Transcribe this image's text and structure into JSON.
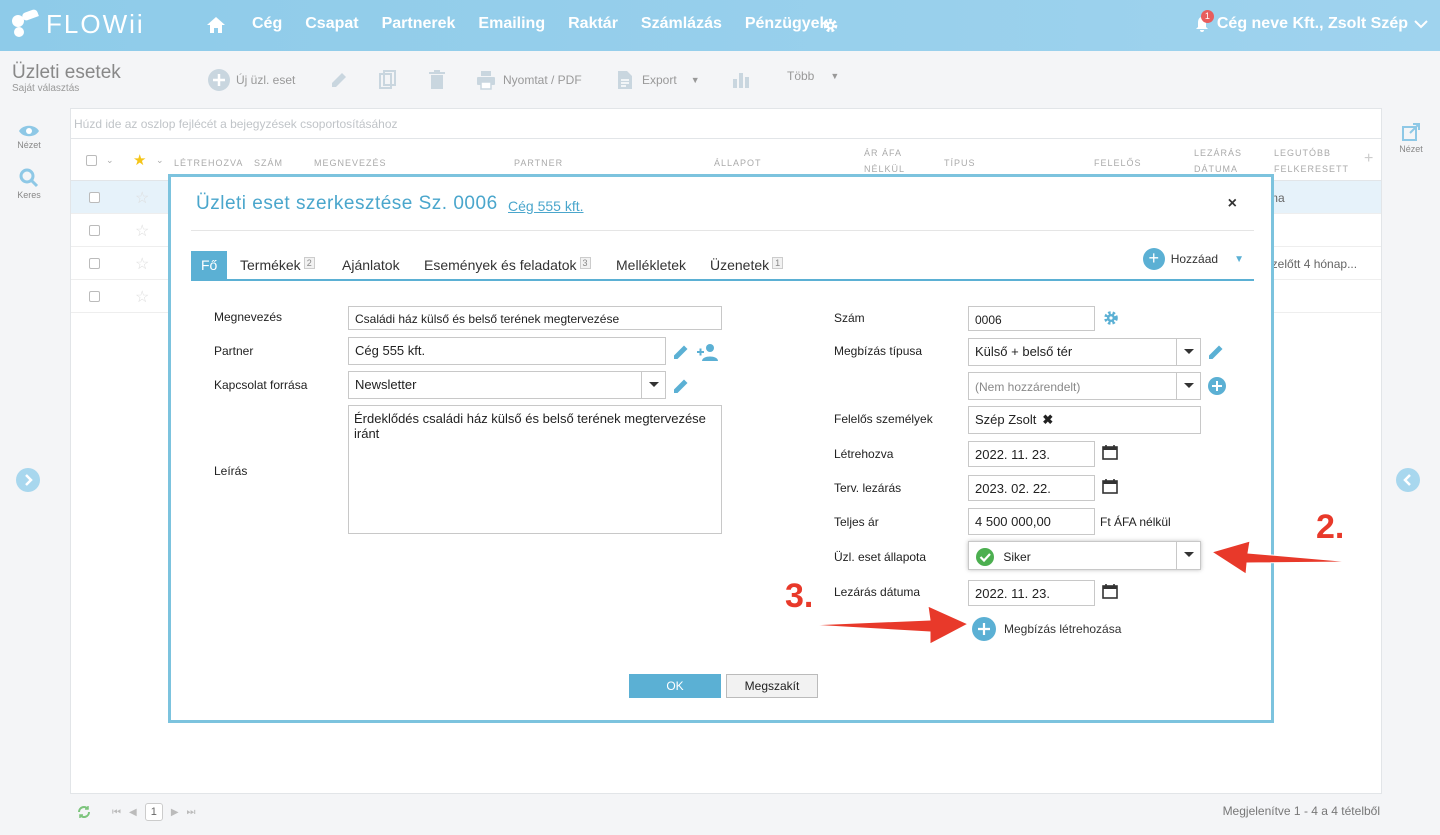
{
  "app": {
    "logo_text": "FLOWii",
    "nav": [
      "Cég",
      "Csapat",
      "Partnerek",
      "Emailing",
      "Raktár",
      "Számlázás",
      "Pénzügyek"
    ],
    "notification_count": "1",
    "account": "Cég neve Kft., Zsolt Szép"
  },
  "toolbar": {
    "title": "Üzleti esetek",
    "subtitle": "Saját választás",
    "new_label": "Új üzl. eset",
    "print_label": "Nyomtat / PDF",
    "export_label": "Export",
    "more_label": "Több"
  },
  "side": {
    "view_label": "Nézet",
    "search_label": "Keres",
    "right_view_label": "Nézet"
  },
  "grid": {
    "group_hint": "Húzd ide az oszlop fejlécét a bejegyzések csoportosításához",
    "columns": {
      "created": "Létrehozva",
      "number": "Szám",
      "name": "Megnevezés",
      "partner": "Partner",
      "status": "Állapot",
      "price_line1": "Ár ÁFA",
      "price_line2": "nélkül",
      "type": "Típus",
      "owner": "Felelős",
      "close_line1": "Lezárás",
      "close_line2": "dátuma",
      "last_line1": "Legutóbb",
      "last_line2": "felkeresett"
    },
    "row1_tail": "ma",
    "row3_tail": "ezelőtt  4 hónap..."
  },
  "footer": {
    "page": "1",
    "info": "Megjelenítve 1 - 4 a 4 tételből"
  },
  "modal": {
    "title": "Üzleti eset szerkesztése Sz. 0006",
    "partner_link": "Cég 555 kft.",
    "close": "×",
    "tabs": [
      {
        "label": "Fő",
        "badge": ""
      },
      {
        "label": "Termékek",
        "badge": "2"
      },
      {
        "label": "Ajánlatok",
        "badge": ""
      },
      {
        "label": "Események és feladatok",
        "badge": "3"
      },
      {
        "label": "Mellékletek",
        "badge": ""
      },
      {
        "label": "Üzenetek",
        "badge": "1"
      }
    ],
    "add_label": "Hozzáad",
    "left": {
      "name_label": "Megnevezés",
      "name_value": "Családi ház külső és belső terének megtervezése",
      "partner_label": "Partner",
      "partner_value": "Cég 555 kft.",
      "source_label": "Kapcsolat forrása",
      "source_value": "Newsletter",
      "desc_label": "Leírás",
      "desc_value": "Érdeklődés családi ház külső és belső terének megtervezése iránt"
    },
    "right": {
      "number_label": "Szám",
      "number_value": "0006",
      "type_label": "Megbízás típusa",
      "type_value": "Külső + belső tér",
      "type2_placeholder": "(Nem hozzárendelt)",
      "owners_label": "Felelős személyek",
      "owner_value": "Szép Zsolt",
      "created_label": "Létrehozva",
      "created_value": "2022. 11. 23.",
      "planned_label": "Terv. lezárás",
      "planned_value": "2023. 02. 22.",
      "price_label": "Teljes ár",
      "price_value": "4 500 000,00",
      "price_unit": "Ft  ÁFA nélkül",
      "status_label": "Üzl. eset állapota",
      "status_value": "Siker",
      "close_label": "Lezárás dátuma",
      "close_value": "2022. 11. 23.",
      "create_order": "Megbízás létrehozása"
    },
    "ok": "OK",
    "cancel": "Megszakít"
  },
  "annotations": {
    "two": "2.",
    "three": "3."
  },
  "colors": {
    "accent": "#5bb0d4",
    "nav_bg": "#9fd3ee",
    "annotation": "#e8392a",
    "success": "#4caf50"
  }
}
